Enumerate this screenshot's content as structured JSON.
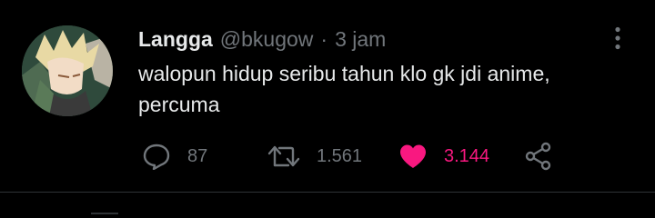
{
  "tweet": {
    "author_name": "Langga",
    "handle": "@bkugow",
    "separator": "·",
    "time": "3 jam",
    "text_line1": "walopun hidup seribu tahun klo gk jdi anime,",
    "text_line2": "percuma"
  },
  "actions": {
    "reply_count": "87",
    "retweet_count": "1.561",
    "like_count": "3.144"
  },
  "icons": {
    "reply": "reply-icon",
    "retweet": "retweet-icon",
    "like": "heart-icon",
    "share": "share-icon",
    "more": "more-vertical-icon"
  },
  "colors": {
    "background": "#000000",
    "text": "#e7e9ea",
    "muted": "#71767b",
    "like": "#f91880"
  }
}
